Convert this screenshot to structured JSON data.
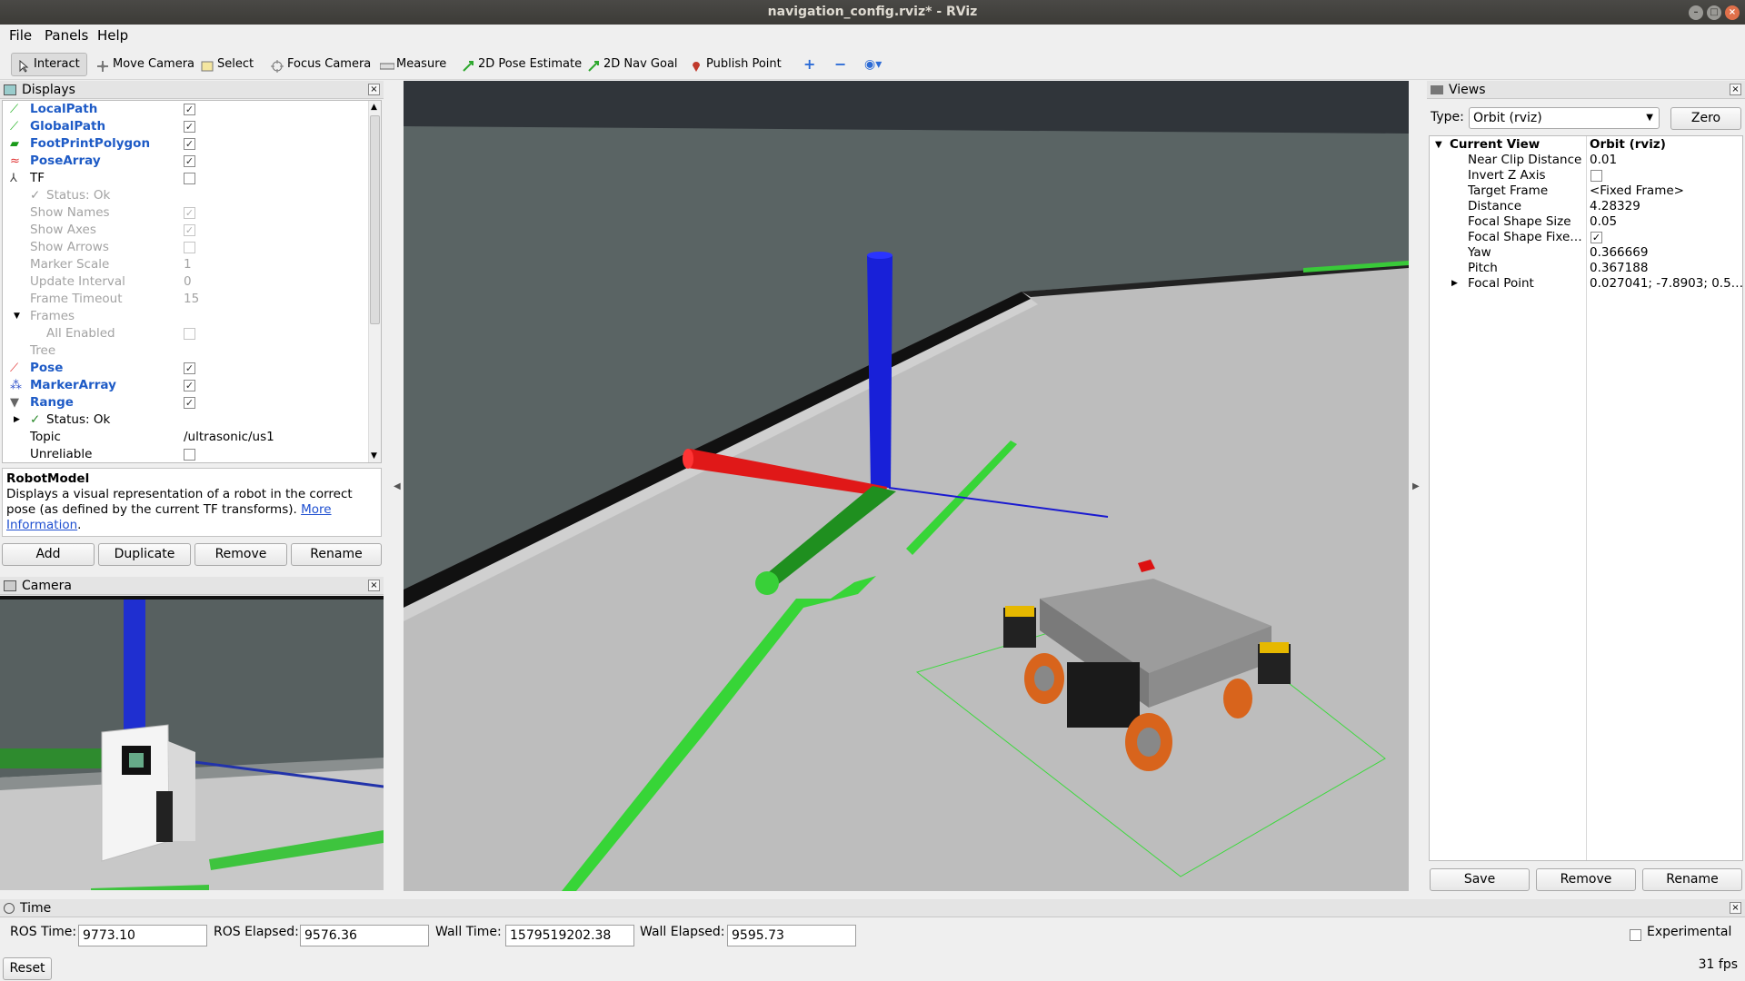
{
  "window": {
    "title": "navigation_config.rviz* - RViz"
  },
  "menu": [
    "File",
    "Panels",
    "Help"
  ],
  "toolbar": {
    "tools": [
      {
        "label": "Interact",
        "icon": "cursor-icon",
        "active": true
      },
      {
        "label": "Move Camera",
        "icon": "move-camera-icon"
      },
      {
        "label": "Select",
        "icon": "select-box-icon"
      },
      {
        "label": "Focus Camera",
        "icon": "focus-camera-icon"
      },
      {
        "label": "Measure",
        "icon": "ruler-icon"
      },
      {
        "label": "2D Pose Estimate",
        "icon": "pose-estimate-arrow-icon"
      },
      {
        "label": "2D Nav Goal",
        "icon": "nav-goal-arrow-icon"
      },
      {
        "label": "Publish Point",
        "icon": "map-pin-icon"
      }
    ]
  },
  "displays": {
    "title": "Displays",
    "rows": [
      {
        "name": "LocalPath",
        "checked": true,
        "style": "blue",
        "icon": "path-icon"
      },
      {
        "name": "GlobalPath",
        "checked": true,
        "style": "blue",
        "icon": "path-icon"
      },
      {
        "name": "FootPrintPolygon",
        "checked": true,
        "style": "blue",
        "icon": "polygon-icon"
      },
      {
        "name": "PoseArray",
        "checked": true,
        "style": "blue",
        "icon": "pose-array-icon"
      },
      {
        "name": "TF",
        "checked": false,
        "style": "normal",
        "icon": "tf-axes-icon"
      },
      {
        "name": "Status: Ok",
        "style": "grey",
        "indent": 1,
        "check_mark": true
      },
      {
        "name": "Show Names",
        "checked": true,
        "style": "grey",
        "indent": 1,
        "disabled": true
      },
      {
        "name": "Show Axes",
        "checked": true,
        "style": "grey",
        "indent": 1,
        "disabled": true
      },
      {
        "name": "Show Arrows",
        "checked": false,
        "style": "grey",
        "indent": 1,
        "disabled": true
      },
      {
        "name": "Marker Scale",
        "value": "1",
        "style": "grey",
        "indent": 1
      },
      {
        "name": "Update Interval",
        "value": "0",
        "style": "grey",
        "indent": 1
      },
      {
        "name": "Frame Timeout",
        "value": "15",
        "style": "grey",
        "indent": 1
      },
      {
        "name": "Frames",
        "style": "grey",
        "indent": 1,
        "expanded": true
      },
      {
        "name": "All Enabled",
        "checked": false,
        "style": "grey",
        "indent": 2,
        "disabled": true
      },
      {
        "name": "Tree",
        "style": "grey",
        "indent": 1
      },
      {
        "name": "Pose",
        "checked": true,
        "style": "blue",
        "icon": "pose-arrow-icon"
      },
      {
        "name": "MarkerArray",
        "checked": true,
        "style": "blue",
        "icon": "marker-array-icon"
      },
      {
        "name": "Range",
        "checked": true,
        "style": "blue",
        "icon": "range-cone-icon"
      },
      {
        "name": "Status: Ok",
        "style": "normal",
        "indent": 1,
        "check_mark": true,
        "collapsed": true
      },
      {
        "name": "Topic",
        "value": "/ultrasonic/us1",
        "style": "normal",
        "indent": 1
      },
      {
        "name": "Unreliable",
        "checked": false,
        "style": "normal",
        "indent": 1
      }
    ],
    "description_title": "RobotModel",
    "description_text": "Displays a visual representation of a robot in the correct pose (as defined by the current TF transforms).",
    "description_link": "More Information",
    "buttons": [
      "Add",
      "Duplicate",
      "Remove",
      "Rename"
    ]
  },
  "camera": {
    "title": "Camera"
  },
  "views": {
    "title": "Views",
    "type_label": "Type:",
    "type_value": "Orbit (rviz)",
    "zero_label": "Zero",
    "header_key": "Current View",
    "header_value": "Orbit (rviz)",
    "props": [
      {
        "key": "Near Clip Distance",
        "value": "0.01"
      },
      {
        "key": "Invert Z Axis",
        "checkbox": true,
        "checked": false
      },
      {
        "key": "Target Frame",
        "value": "<Fixed Frame>"
      },
      {
        "key": "Distance",
        "value": "4.28329"
      },
      {
        "key": "Focal Shape Size",
        "value": "0.05"
      },
      {
        "key": "Focal Shape Fixe…",
        "checkbox": true,
        "checked": true
      },
      {
        "key": "Yaw",
        "value": "0.366669"
      },
      {
        "key": "Pitch",
        "value": "0.367188"
      },
      {
        "key": "Focal Point",
        "value": "0.027041; -7.8903; 0.5…",
        "collapsed": true
      }
    ],
    "buttons": [
      "Save",
      "Remove",
      "Rename"
    ]
  },
  "time": {
    "title": "Time",
    "ros_time_label": "ROS Time:",
    "ros_time": "9773.10",
    "ros_elapsed_label": "ROS Elapsed:",
    "ros_elapsed": "9576.36",
    "wall_time_label": "Wall Time:",
    "wall_time": "1579519202.38",
    "wall_elapsed_label": "Wall Elapsed:",
    "wall_elapsed": "9595.73",
    "experimental_label": "Experimental",
    "reset_label": "Reset",
    "fps": "31 fps"
  }
}
